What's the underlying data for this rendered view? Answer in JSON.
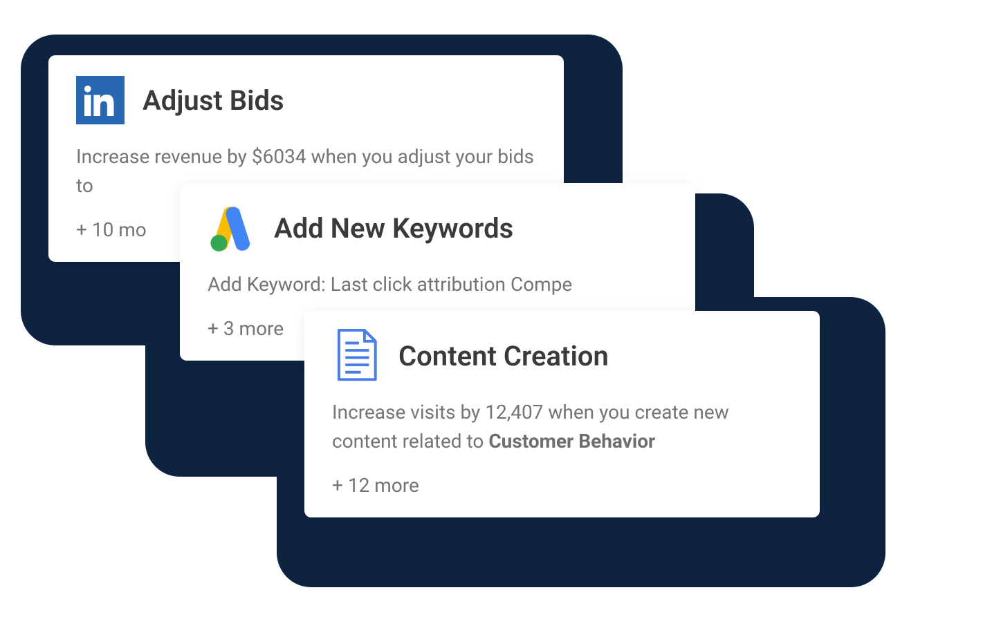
{
  "cards": [
    {
      "title": "Adjust Bids",
      "description_pre": "Increase revenue by $6034 when you adjust your bids to",
      "description_bold": "",
      "more": "+ 10 mo"
    },
    {
      "title": "Add New Keywords",
      "description_pre": "Add Keyword: Last click attribution Compe",
      "description_bold": "",
      "more": "+ 3 more"
    },
    {
      "title": "Content Creation",
      "description_pre": "Increase visits by 12,407 when you create new content related to ",
      "description_bold": "Customer Behavior",
      "more": "+ 12 more"
    }
  ]
}
